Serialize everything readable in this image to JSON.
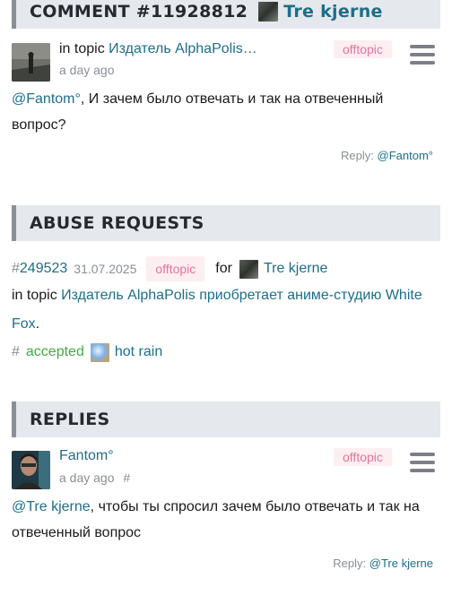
{
  "comment_section": {
    "title": "COMMENT #11928812",
    "author": "Tre kjerne",
    "topic_prefix": "in topic",
    "topic_link": "Издатель AlphaPolis…",
    "time": "a day ago",
    "tag": "offtopic",
    "mention": "@Fantom°",
    "body": ", И зачем было отвечать и так на отвеченный вопрос?",
    "reply_label": "Reply:",
    "reply_to": "@Fantom°"
  },
  "abuse_section": {
    "title": "ABUSE REQUESTS",
    "hash": "#",
    "request_id": "249523",
    "date": "31.07.2025",
    "tag": "offtopic",
    "for_label": "for",
    "for_user": "Tre kjerne",
    "topic_prefix": "in topic",
    "topic_link": "Издатель AlphaPolis приобретает аниме-студию White Fox",
    "topic_suffix": ".",
    "status_hash": "#",
    "status": "accepted",
    "moderator": "hot rain"
  },
  "replies_section": {
    "title": "REPLIES",
    "author": "Fantom°",
    "time": "a day ago",
    "hash": "#",
    "tag": "offtopic",
    "mention": "@Tre kjerne",
    "body": ", чтобы ты спросил зачем было отвечать и так на отвеченный вопрос",
    "reply_label": "Reply:",
    "reply_to": "@Tre kjerne"
  },
  "colors": {
    "link": "#1d6e8a",
    "accepted": "#3fae3f",
    "tag_text": "#e4749a",
    "tag_bg": "#fdeef2",
    "header_bg": "#e5e8ec"
  },
  "icons": [
    "menu-icon",
    "user-avatar-thumbnail"
  ]
}
